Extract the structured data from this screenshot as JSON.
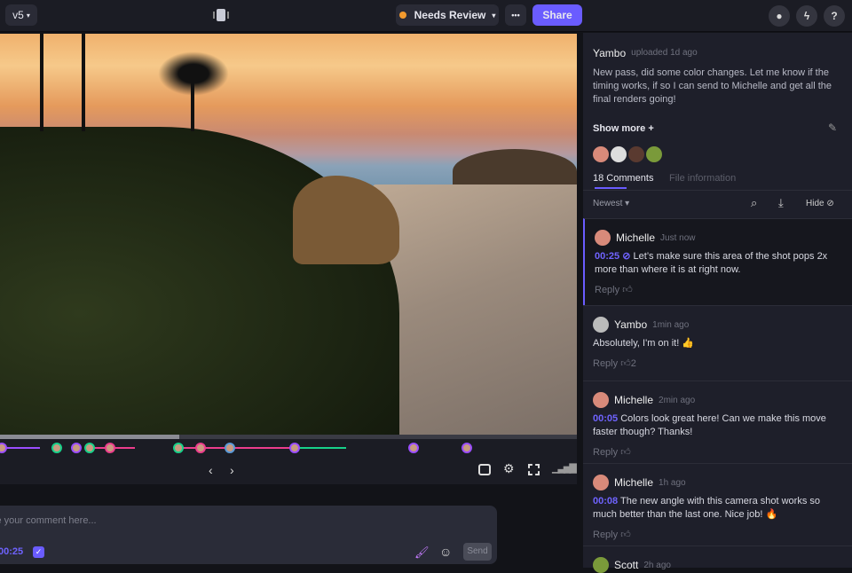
{
  "header": {
    "version": "v5",
    "status": "Needs Review",
    "status_color": "#f29a2e",
    "more": "•••",
    "share": "Share",
    "accent": "#6a5cff"
  },
  "player": {
    "nav_prev": "‹",
    "nav_next": "›",
    "playhead_percent": 31
  },
  "composer": {
    "placeholder": "ve your comment here...",
    "timestamp": "00:25",
    "send": "Send"
  },
  "panel": {
    "uploader": "Yambo",
    "uploaded": "uploaded 1d ago",
    "description": "New pass, did some color changes. Let me know if the timing works, if so I can send to Michelle and get all the final renders going!",
    "show_more": "Show more +",
    "tabs": [
      "18 Comments",
      "File information"
    ],
    "sort": "Newest",
    "hide": "Hide",
    "reply": "Reply",
    "comments": [
      {
        "name": "Michelle",
        "time": "Just now",
        "ts": "00:25",
        "text": "Let’s make sure this area of the shot pops 2x more than where it is at right now.",
        "likes": ""
      },
      {
        "name": "Yambo",
        "time": "1min ago",
        "ts": "",
        "text": "Absolutely, I'm on it! 👍",
        "likes": "2"
      },
      {
        "name": "Michelle",
        "time": "2min ago",
        "ts": "00:05",
        "text": "Colors look great here! Can we make this move faster though? Thanks!",
        "likes": ""
      },
      {
        "name": "Michelle",
        "time": "1h ago",
        "ts": "00:08",
        "text": "The new angle with this camera shot works so much better than the last one. Nice job! 🔥",
        "likes": ""
      },
      {
        "name": "Scott",
        "time": "2h ago",
        "ts": "",
        "text": "",
        "likes": ""
      }
    ]
  }
}
